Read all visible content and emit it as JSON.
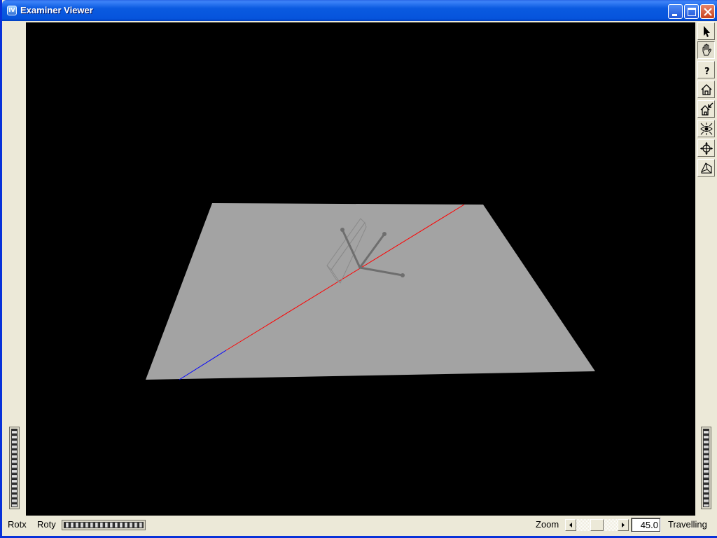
{
  "window": {
    "title": "Examiner Viewer",
    "icon_letters": "IV"
  },
  "caption_buttons": [
    "minimize-icon",
    "maximize-icon",
    "close-icon"
  ],
  "toolbar": {
    "buttons": [
      {
        "name": "select-mode",
        "icon": "arrow-pointer-icon"
      },
      {
        "name": "view-mode",
        "icon": "hand-icon",
        "pressed": true
      },
      {
        "name": "help",
        "icon": "question-mark-icon",
        "glyph": "?"
      },
      {
        "name": "home",
        "icon": "house-icon"
      },
      {
        "name": "set-home",
        "icon": "house-arrow-icon"
      },
      {
        "name": "view-all",
        "icon": "eye-icon"
      },
      {
        "name": "seek",
        "icon": "crosshair-icon"
      },
      {
        "name": "perspective-toggle",
        "icon": "perspective-cube-icon"
      }
    ]
  },
  "bottom": {
    "rotx_label": "Rotx",
    "roty_label": "Roty",
    "zoom_label": "Zoom",
    "zoom_value": "45.0",
    "dolly_label": "Travelling"
  },
  "scene": {
    "background": "#000000",
    "plane_color": "#a3a3a3",
    "axis_red": "#ff0000",
    "axis_blue": "#0000ff",
    "wire_color": "#777777"
  }
}
